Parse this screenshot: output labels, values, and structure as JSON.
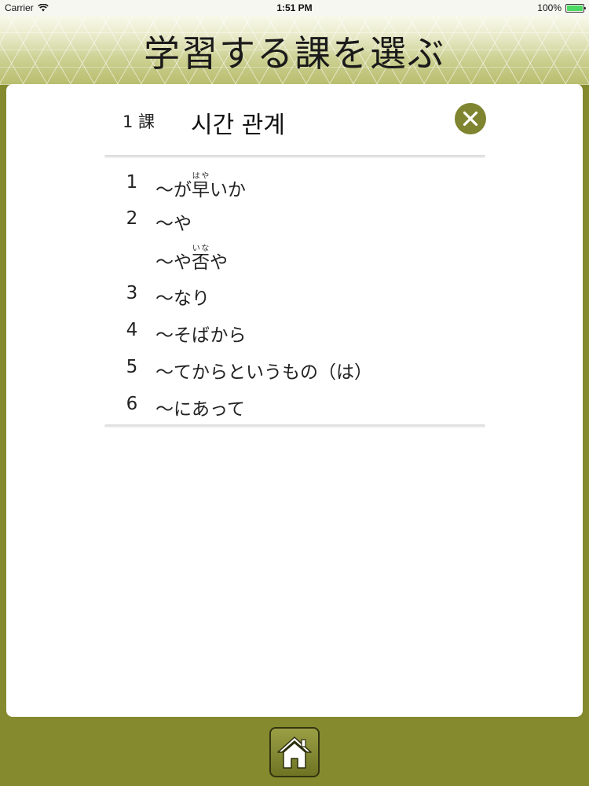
{
  "status_bar": {
    "carrier": "Carrier",
    "time": "1:51 PM",
    "battery": "100%"
  },
  "header": {
    "title": "学習する課を選ぶ"
  },
  "lesson": {
    "number_label": "1 課",
    "title": "시간 관계"
  },
  "items": [
    {
      "number": "1",
      "prefix": "〜が",
      "ruby_base": "早",
      "ruby_text": "はや",
      "suffix": "いか"
    },
    {
      "number": "2",
      "text": "〜や"
    },
    {
      "number": "",
      "prefix": "〜や",
      "ruby_base": "否",
      "ruby_text": "いな",
      "suffix": "や"
    },
    {
      "number": "3",
      "text": "〜なり"
    },
    {
      "number": "4",
      "text": "〜そばから"
    },
    {
      "number": "5",
      "text": "〜てからというもの（は）"
    },
    {
      "number": "6",
      "text": "〜にあって"
    }
  ],
  "icons": {
    "close": "close-icon",
    "home": "home-icon",
    "wifi": "wifi-icon",
    "battery": "battery-icon"
  },
  "colors": {
    "olive": "#858a2f",
    "close_button": "#7f8430",
    "battery_fill": "#4cd964"
  }
}
